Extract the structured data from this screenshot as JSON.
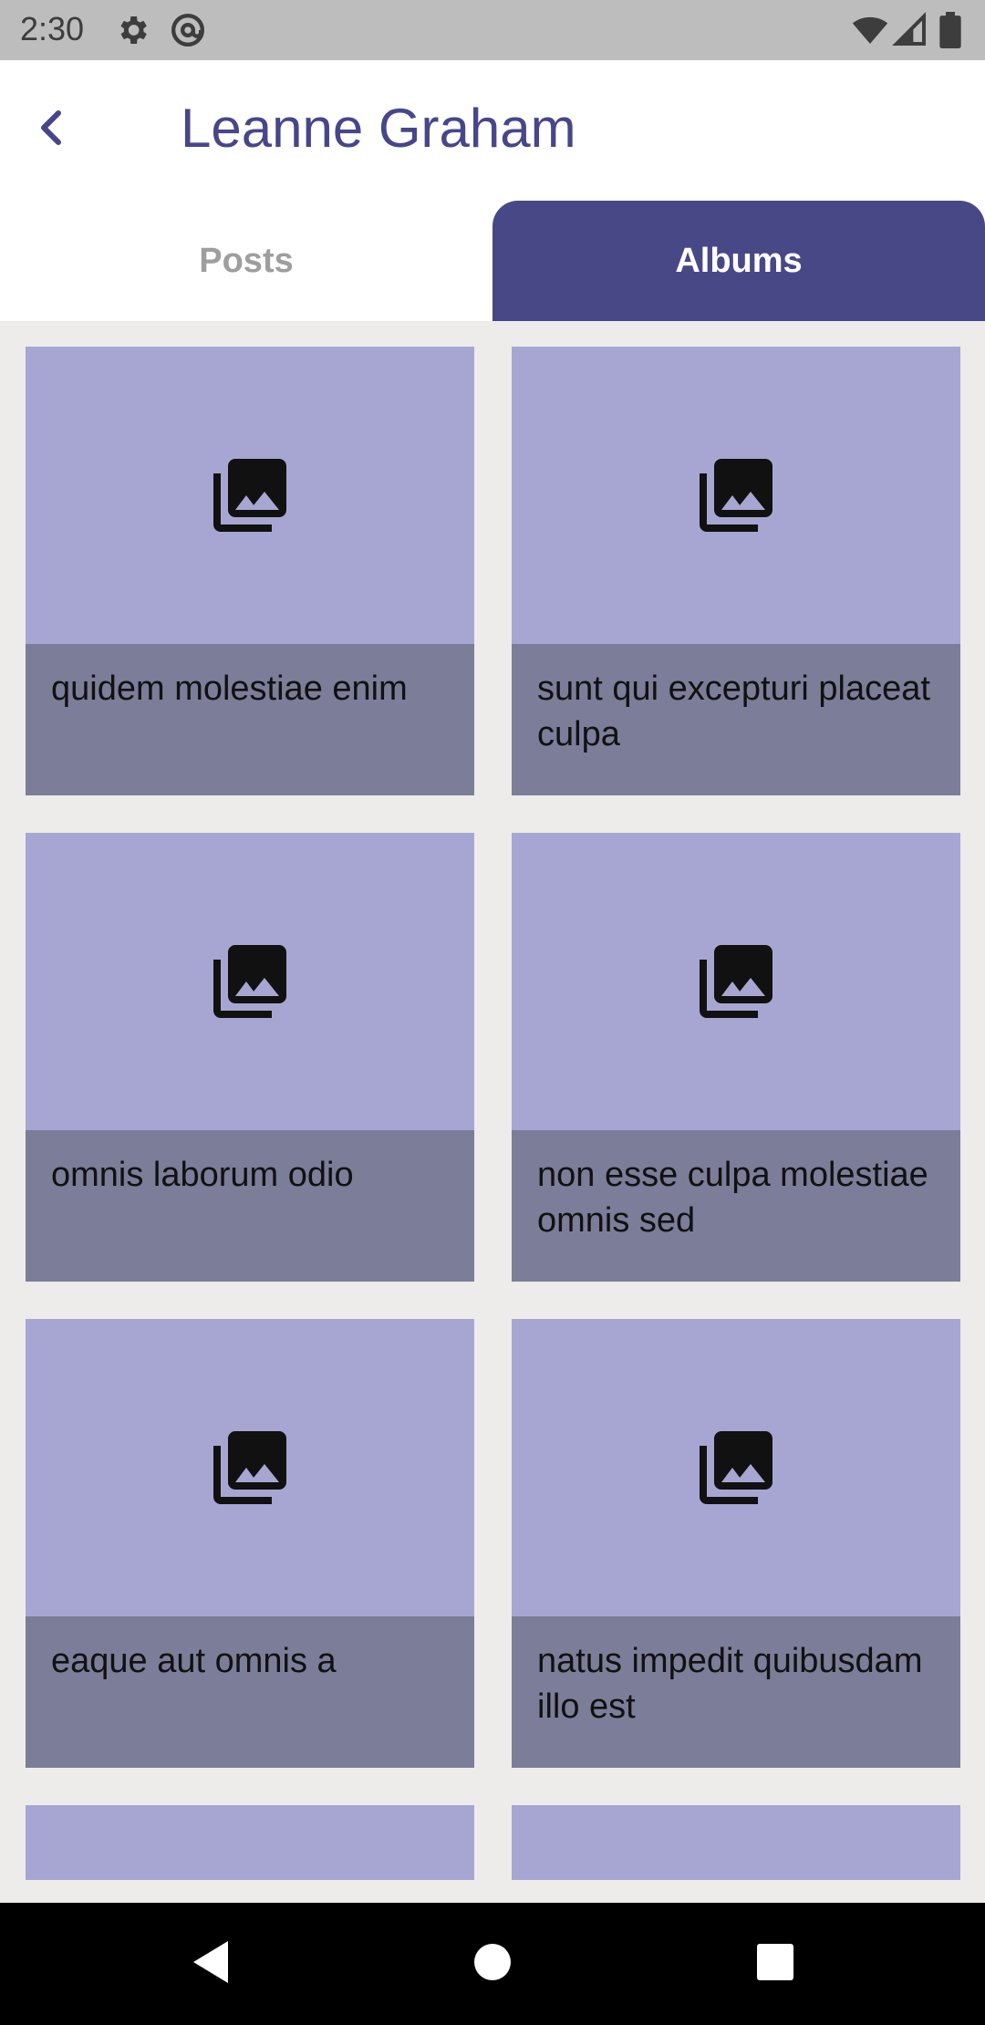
{
  "status_bar": {
    "time": "2:30",
    "icons": [
      "settings-icon",
      "at-sign-icon",
      "wifi-icon",
      "signal-icon",
      "battery-icon"
    ]
  },
  "app_bar": {
    "title": "Leanne Graham",
    "back_icon": "chevron-left-icon",
    "title_color": "#47468a"
  },
  "tabs": [
    {
      "label": "Posts",
      "selected": false
    },
    {
      "label": "Albums",
      "selected": true
    }
  ],
  "albums": [
    {
      "title": "quidem molestiae enim",
      "icon": "photo-library-icon"
    },
    {
      "title": "sunt qui excepturi placeat culpa",
      "icon": "photo-library-icon"
    },
    {
      "title": "omnis laborum odio",
      "icon": "photo-library-icon"
    },
    {
      "title": "non esse culpa molestiae omnis sed",
      "icon": "photo-library-icon"
    },
    {
      "title": "eaque aut omnis a",
      "icon": "photo-library-icon"
    },
    {
      "title": "natus impedit quibusdam illo est",
      "icon": "photo-library-icon"
    }
  ],
  "colors": {
    "accent": "#494887",
    "thumb_bg": "#a7a6d2",
    "caption_bg": "#7c7d99",
    "grid_bg": "#edeceb"
  },
  "nav_bar": {
    "icons": [
      "back-triangle-icon",
      "home-circle-icon",
      "recents-square-icon"
    ]
  }
}
